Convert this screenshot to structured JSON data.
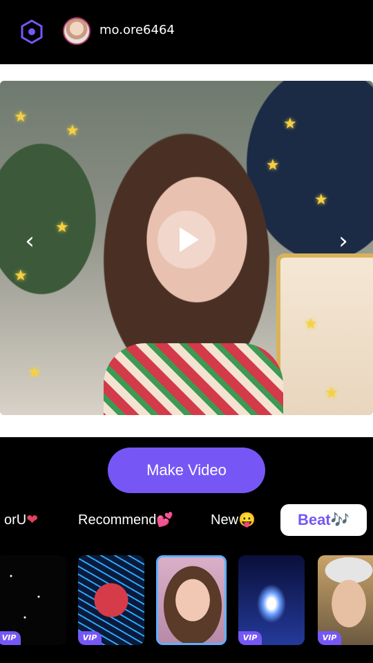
{
  "header": {
    "username": "mo.ore6464",
    "logo_icon": "hexagon-icon",
    "accent": "#7657f6"
  },
  "preview": {
    "prev_icon": "chevron-left-icon",
    "next_icon": "chevron-right-icon",
    "play_icon": "play-icon"
  },
  "actions": {
    "make_video_label": "Make Video"
  },
  "tabs": [
    {
      "label": "orU",
      "emoji": "❤"
    },
    {
      "label": "Recommend",
      "emoji": "💕"
    },
    {
      "label": "New",
      "emoji": "😛"
    },
    {
      "label": "Beat",
      "emoji": "🎶",
      "selected": true
    }
  ],
  "thumbnails": [
    {
      "badge": "VIP"
    },
    {
      "badge": "VIP"
    },
    {
      "badge": "",
      "selected": true
    },
    {
      "badge": "VIP"
    },
    {
      "badge": "VIP"
    }
  ]
}
